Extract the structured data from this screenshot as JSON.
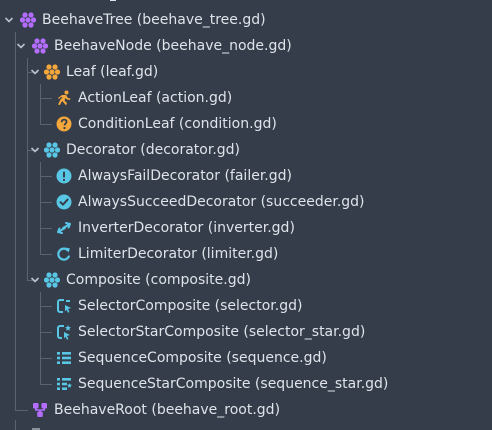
{
  "tree": {
    "nodes": [
      {
        "label": "BeehaveTree (beehave_tree.gd)",
        "icon": "hive-icon",
        "expanded": true
      },
      {
        "label": "BeehaveNode (beehave_node.gd)",
        "icon": "hive-icon",
        "expanded": true
      },
      {
        "label": "Leaf (leaf.gd)",
        "icon": "hive-icon",
        "expanded": true
      },
      {
        "label": "ActionLeaf (action.gd)",
        "icon": "running-person-icon"
      },
      {
        "label": "ConditionLeaf (condition.gd)",
        "icon": "question-icon"
      },
      {
        "label": "Decorator (decorator.gd)",
        "icon": "hive-icon",
        "expanded": true
      },
      {
        "label": "AlwaysFailDecorator (failer.gd)",
        "icon": "exclamation-icon"
      },
      {
        "label": "AlwaysSucceedDecorator (succeeder.gd)",
        "icon": "check-icon"
      },
      {
        "label": "InverterDecorator (inverter.gd)",
        "icon": "swap-arrows-icon"
      },
      {
        "label": "LimiterDecorator (limiter.gd)",
        "icon": "refresh-icon"
      },
      {
        "label": "Composite (composite.gd)",
        "icon": "hive-icon",
        "expanded": true
      },
      {
        "label": "SelectorComposite (selector.gd)",
        "icon": "selector-icon"
      },
      {
        "label": "SelectorStarComposite (selector_star.gd)",
        "icon": "selector-star-icon"
      },
      {
        "label": "SequenceComposite (sequence.gd)",
        "icon": "sequence-icon"
      },
      {
        "label": "SequenceStarComposite (sequence_star.gd)",
        "icon": "sequence-star-icon"
      },
      {
        "label": "BeehaveRoot (beehave_root.gd)",
        "icon": "root-icon"
      }
    ]
  },
  "colors": {
    "background": "#363d4a",
    "text": "#dfe3ea",
    "guide": "#5b6372",
    "arrow": "#b9c0cc",
    "purple": "#b36dff",
    "orange": "#f4a73b",
    "cyan": "#58c7e6",
    "blue": "#4fa7f0"
  }
}
